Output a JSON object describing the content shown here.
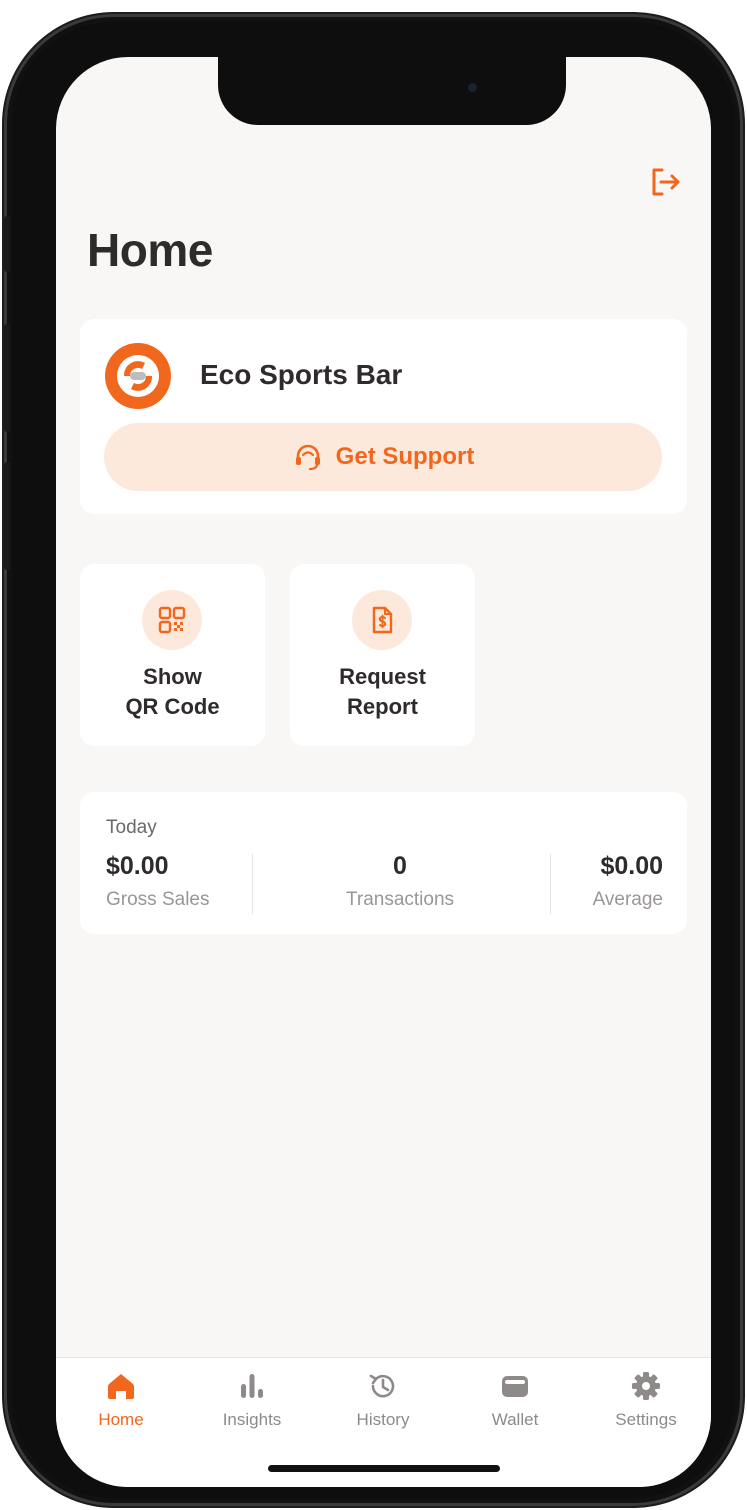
{
  "header": {
    "title": "Home",
    "logout_icon": "logout-icon"
  },
  "merchant": {
    "name": "Eco Sports Bar",
    "support_label": "Get Support",
    "logo_icon": "merchant-logo-icon"
  },
  "actions": [
    {
      "line1": "Show",
      "line2": "QR Code",
      "icon": "qr-code-icon"
    },
    {
      "line1": "Request",
      "line2": "Report",
      "icon": "report-icon"
    }
  ],
  "today": {
    "label": "Today",
    "gross_sales": {
      "value": "$0.00",
      "caption": "Gross Sales"
    },
    "transactions": {
      "value": "0",
      "caption": "Transactions"
    },
    "average": {
      "value": "$0.00",
      "caption": "Average"
    }
  },
  "tabs": [
    {
      "label": "Home",
      "icon": "home-icon",
      "active": true
    },
    {
      "label": "Insights",
      "icon": "bar-chart-icon",
      "active": false
    },
    {
      "label": "History",
      "icon": "history-icon",
      "active": false
    },
    {
      "label": "Wallet",
      "icon": "wallet-icon",
      "active": false
    },
    {
      "label": "Settings",
      "icon": "gear-icon",
      "active": false
    }
  ],
  "colors": {
    "accent": "#f0671d",
    "accent_light": "#fde9dc",
    "background": "#f8f7f6",
    "text": "#2f2b2b"
  }
}
